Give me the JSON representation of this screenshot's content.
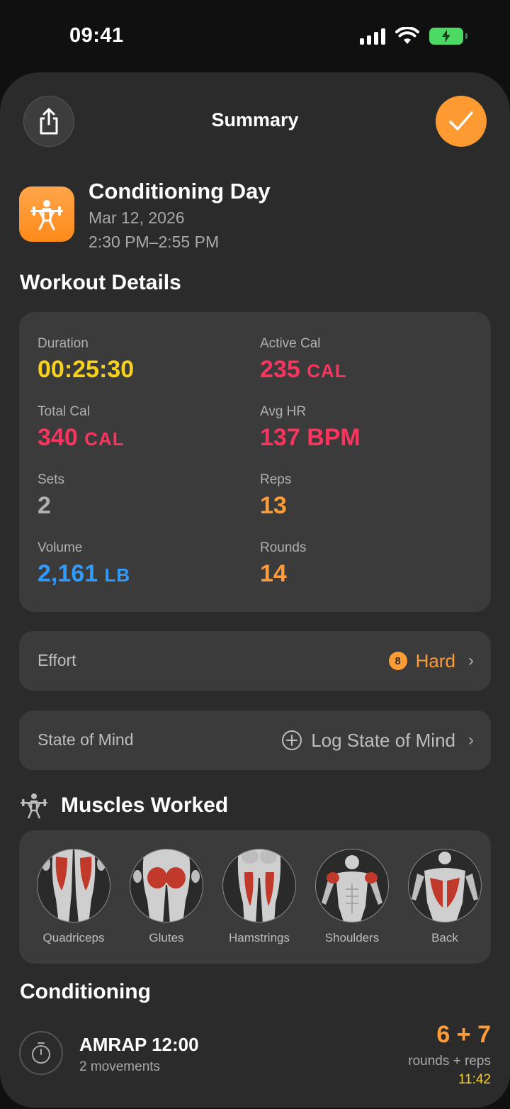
{
  "status_bar": {
    "time": "09:41"
  },
  "header": {
    "title": "Summary"
  },
  "workout": {
    "name": "Conditioning Day",
    "date": "Mar 12, 2026",
    "time_range": "2:30 PM–2:55 PM"
  },
  "details": {
    "section_title": "Workout Details",
    "duration": {
      "label": "Duration",
      "value": "00:25:30"
    },
    "active_cal": {
      "label": "Active Cal",
      "value": "235",
      "unit": "CAL"
    },
    "total_cal": {
      "label": "Total Cal",
      "value": "340",
      "unit": "CAL"
    },
    "avg_hr": {
      "label": "Avg HR",
      "value": "137",
      "unit": "BPM"
    },
    "sets": {
      "label": "Sets",
      "value": "2"
    },
    "reps": {
      "label": "Reps",
      "value": "13"
    },
    "volume": {
      "label": "Volume",
      "value": "2,161",
      "unit": "LB"
    },
    "rounds": {
      "label": "Rounds",
      "value": "14"
    }
  },
  "effort": {
    "label": "Effort",
    "score": "8",
    "value": "Hard"
  },
  "state_of_mind": {
    "label": "State of Mind",
    "action": "Log State of Mind"
  },
  "muscles": {
    "section_title": "Muscles Worked",
    "items": [
      "Quadriceps",
      "Glutes",
      "Hamstrings",
      "Shoulders",
      "Back"
    ]
  },
  "conditioning": {
    "section_title": "Conditioning",
    "name": "AMRAP 12:00",
    "subtitle": "2 movements",
    "score": "6 + 7",
    "score_label": "rounds + reps",
    "time": "11:42"
  },
  "colors": {
    "accent_orange": "#ff9c35",
    "duration_yellow": "#f7d11a",
    "calorie_red": "#f9345f",
    "volume_blue": "#2f9bff",
    "battery_green": "#4cd964"
  }
}
